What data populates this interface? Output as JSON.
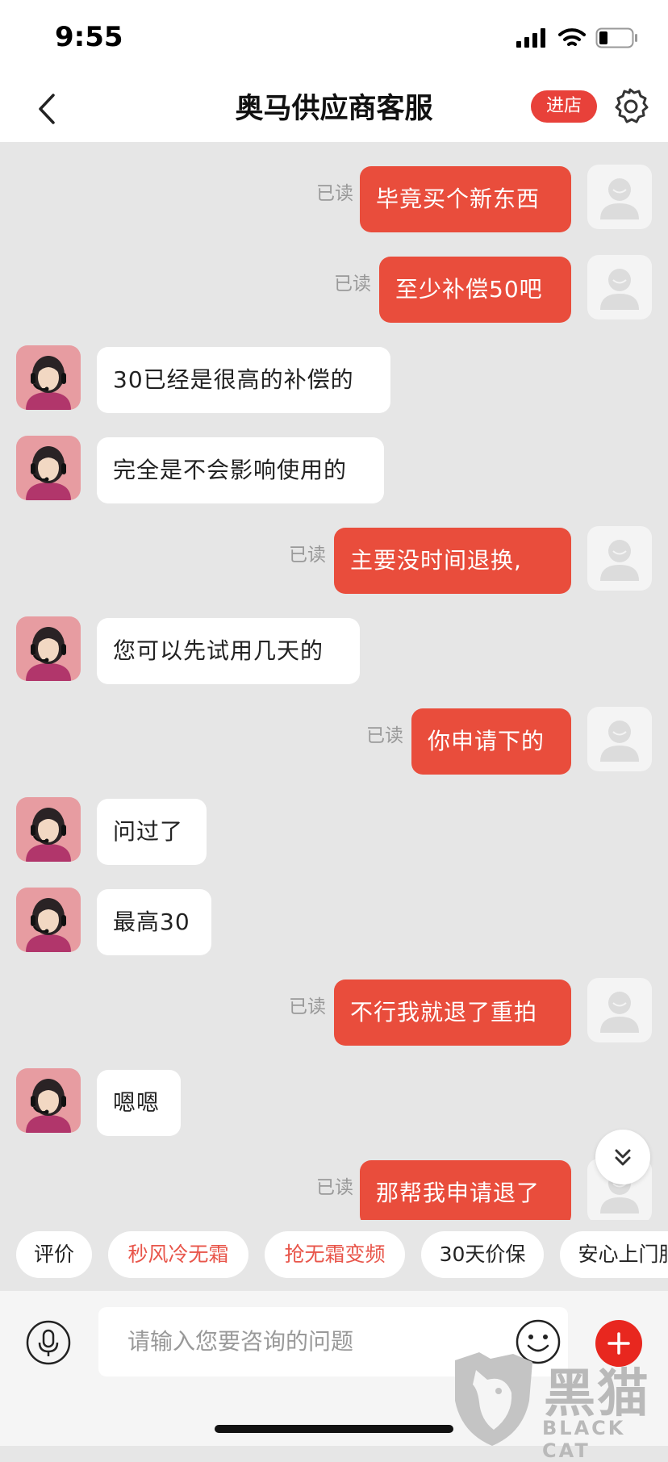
{
  "status": {
    "time": "9:55"
  },
  "header": {
    "title": "奥马供应商客服",
    "enter_store": "进店"
  },
  "messages": [
    {
      "side": "out",
      "text": "毕竟买个新东西",
      "read": "已读"
    },
    {
      "side": "out",
      "text": "至少补偿50吧",
      "read": "已读"
    },
    {
      "side": "in",
      "text": "30已经是很高的补偿的"
    },
    {
      "side": "in",
      "text": "完全是不会影响使用的"
    },
    {
      "side": "out",
      "text": "主要没时间退换,",
      "read": "已读"
    },
    {
      "side": "in",
      "text": "您可以先试用几天的"
    },
    {
      "side": "out",
      "text": "你申请下的",
      "read": "已读"
    },
    {
      "side": "in",
      "text": "问过了"
    },
    {
      "side": "in",
      "text": "最高30"
    },
    {
      "side": "out",
      "text": "不行我就退了重拍",
      "read": "已读"
    },
    {
      "side": "in",
      "text": "嗯嗯"
    },
    {
      "side": "out",
      "text": "那帮我申请退了",
      "read": "已读"
    }
  ],
  "quick_replies": [
    "评价",
    "秒风冷无霜",
    "抢无霜变频",
    "30天价保",
    "安心上门服"
  ],
  "input": {
    "placeholder": "请输入您要咨询的问题"
  },
  "watermark": {
    "cn": "黑猫",
    "en": "BLACK CAT"
  },
  "colors": {
    "accent": "#e94d3c",
    "chat_bg": "#e6e6e6",
    "agent_avatar": "#e79ca1"
  }
}
